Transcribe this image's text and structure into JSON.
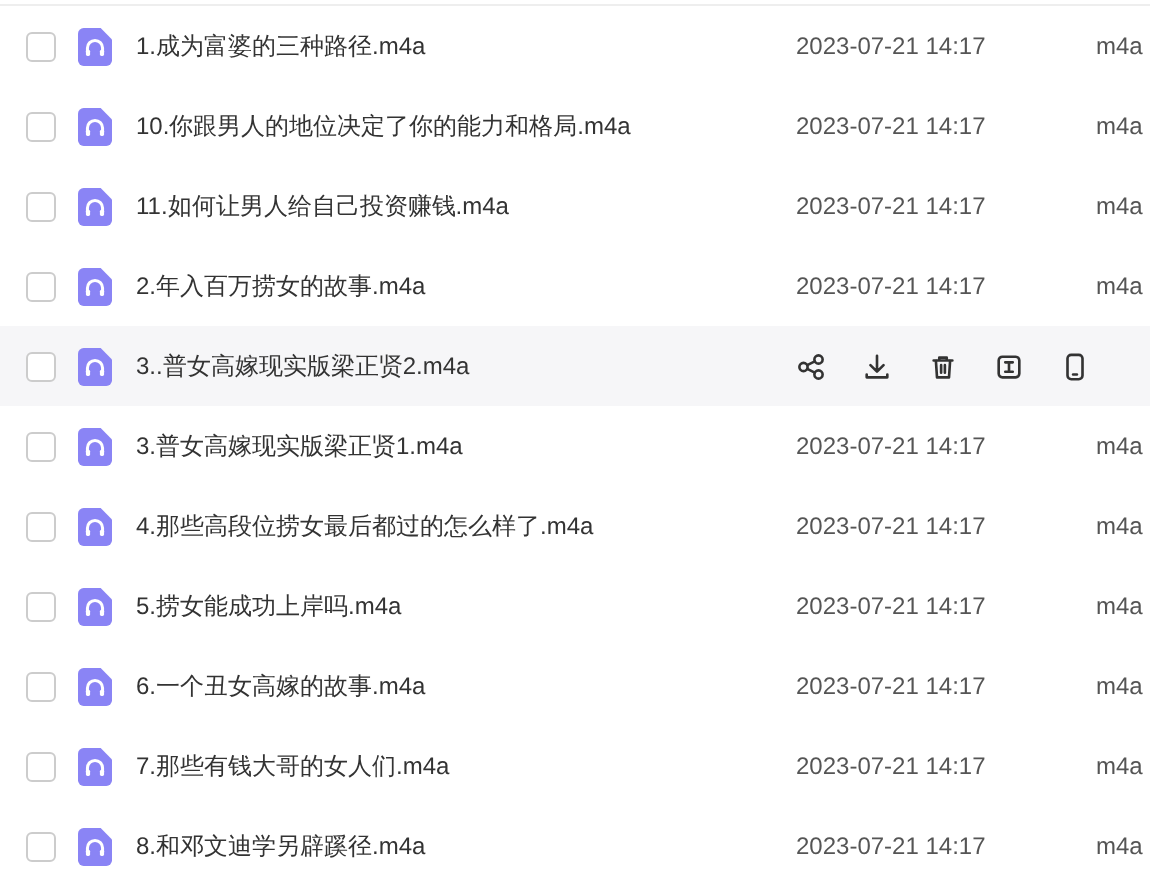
{
  "files": [
    {
      "name": "1.成为富婆的三种路径.m4a",
      "date": "2023-07-21 14:17",
      "extension": "m4a",
      "checked": false,
      "hovered": false
    },
    {
      "name": "10.你跟男人的地位决定了你的能力和格局.m4a",
      "date": "2023-07-21 14:17",
      "extension": "m4a",
      "checked": false,
      "hovered": false
    },
    {
      "name": "11.如何让男人给自己投资赚钱.m4a",
      "date": "2023-07-21 14:17",
      "extension": "m4a",
      "checked": false,
      "hovered": false
    },
    {
      "name": "2.年入百万捞女的故事.m4a",
      "date": "2023-07-21 14:17",
      "extension": "m4a",
      "checked": false,
      "hovered": false
    },
    {
      "name": "3..普女高嫁现实版梁正贤2.m4a",
      "checked": false,
      "hovered": true
    },
    {
      "name": "3.普女高嫁现实版梁正贤1.m4a",
      "date": "2023-07-21 14:17",
      "extension": "m4a",
      "checked": false,
      "hovered": false
    },
    {
      "name": "4.那些高段位捞女最后都过的怎么样了.m4a",
      "date": "2023-07-21 14:17",
      "extension": "m4a",
      "checked": false,
      "hovered": false
    },
    {
      "name": "5.捞女能成功上岸吗.m4a",
      "date": "2023-07-21 14:17",
      "extension": "m4a",
      "checked": false,
      "hovered": false
    },
    {
      "name": "6.一个丑女高嫁的故事.m4a",
      "date": "2023-07-21 14:17",
      "extension": "m4a",
      "checked": false,
      "hovered": false
    },
    {
      "name": "7.那些有钱大哥的女人们.m4a",
      "date": "2023-07-21 14:17",
      "extension": "m4a",
      "checked": false,
      "hovered": false
    },
    {
      "name": "8.和邓文迪学另辟蹊径.m4a",
      "date": "2023-07-21 14:17",
      "extension": "m4a",
      "checked": false,
      "hovered": false
    }
  ]
}
